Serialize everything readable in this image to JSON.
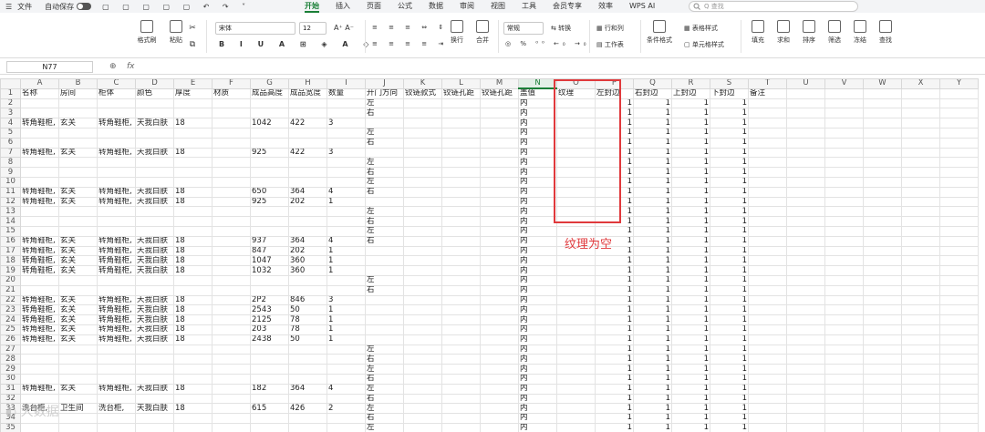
{
  "titlebar": {
    "file": "文件",
    "autosave": "自动保存",
    "tabs": [
      "开始",
      "插入",
      "页面",
      "公式",
      "数据",
      "审阅",
      "视图",
      "工具",
      "会员专享",
      "效率",
      "WPS AI"
    ],
    "active_tab": "开始",
    "search_placeholder": "Q 查找"
  },
  "ribbon": {
    "format_painter": "格式刷",
    "paste": "粘贴",
    "font": "宋体",
    "font_size": "12",
    "number_format": "常规",
    "convert": "转换",
    "wrap": "换行",
    "merge": "合并",
    "rows_cols": "行和列",
    "worksheet": "工作表",
    "conditional": "条件格式",
    "table_style": "表格样式",
    "cell_style": "单元格样式",
    "fill": "填充",
    "sum": "求和",
    "sort": "排序",
    "filter": "筛选",
    "freeze": "冻结",
    "find": "查找"
  },
  "formula": {
    "namebox": "N77",
    "fx": "fx"
  },
  "grid": {
    "columns": [
      "A",
      "B",
      "C",
      "D",
      "E",
      "F",
      "G",
      "H",
      "I",
      "J",
      "K",
      "L",
      "M",
      "N",
      "O",
      "P",
      "Q",
      "R",
      "S",
      "T",
      "U",
      "V",
      "W",
      "X",
      "Y"
    ],
    "selected_column": "N",
    "header_row": [
      "名称",
      "房间",
      "柜体",
      "颜色",
      "厚度",
      "材质",
      "成品高度",
      "成品宽度",
      "数量",
      "开门方向",
      "铰链款式",
      "铰链孔距",
      "铰链孔距",
      "盖值",
      "纹理",
      "左封边",
      "右封边",
      "上封边",
      "下封边",
      "备注"
    ],
    "rows": [
      [
        "",
        "",
        "",
        "",
        "",
        "",
        "",
        "",
        "",
        "左",
        "",
        "",
        "",
        "内",
        "",
        "1",
        "1",
        "1",
        "1"
      ],
      [
        "",
        "",
        "",
        "",
        "",
        "",
        "",
        "",
        "",
        "右",
        "",
        "",
        "",
        "内",
        "",
        "1",
        "1",
        "1",
        "1"
      ],
      [
        "转角鞋柜,",
        "玄关",
        "转角鞋柜,",
        "天我白肤",
        "18",
        "",
        "1042",
        "422",
        "3",
        "",
        "",
        "",
        "",
        "内",
        "",
        "1",
        "1",
        "1",
        "1"
      ],
      [
        "",
        "",
        "",
        "",
        "",
        "",
        "",
        "",
        "",
        "左",
        "",
        "",
        "",
        "内",
        "",
        "1",
        "1",
        "1",
        "1"
      ],
      [
        "",
        "",
        "",
        "",
        "",
        "",
        "",
        "",
        "",
        "右",
        "",
        "",
        "",
        "内",
        "",
        "1",
        "1",
        "1",
        "1"
      ],
      [
        "转角鞋柜,",
        "玄关",
        "转角鞋柜,",
        "天我白肤",
        "18",
        "",
        "925",
        "422",
        "3",
        "",
        "",
        "",
        "",
        "内",
        "",
        "1",
        "1",
        "1",
        "1"
      ],
      [
        "",
        "",
        "",
        "",
        "",
        "",
        "",
        "",
        "",
        "左",
        "",
        "",
        "",
        "内",
        "",
        "1",
        "1",
        "1",
        "1"
      ],
      [
        "",
        "",
        "",
        "",
        "",
        "",
        "",
        "",
        "",
        "右",
        "",
        "",
        "",
        "内",
        "",
        "1",
        "1",
        "1",
        "1"
      ],
      [
        "",
        "",
        "",
        "",
        "",
        "",
        "",
        "",
        "",
        "左",
        "",
        "",
        "",
        "内",
        "",
        "1",
        "1",
        "1",
        "1"
      ],
      [
        "转角鞋柜,",
        "玄关",
        "转角鞋柜,",
        "天我白肤",
        "18",
        "",
        "650",
        "364",
        "4",
        "右",
        "",
        "",
        "",
        "内",
        "",
        "1",
        "1",
        "1",
        "1"
      ],
      [
        "转角鞋柜,",
        "玄关",
        "转角鞋柜,",
        "天我白肤",
        "18",
        "",
        "925",
        "202",
        "1",
        "",
        "",
        "",
        "",
        "内",
        "",
        "1",
        "1",
        "1",
        "1"
      ],
      [
        "",
        "",
        "",
        "",
        "",
        "",
        "",
        "",
        "",
        "左",
        "",
        "",
        "",
        "内",
        "",
        "1",
        "1",
        "1",
        "1"
      ],
      [
        "",
        "",
        "",
        "",
        "",
        "",
        "",
        "",
        "",
        "右",
        "",
        "",
        "",
        "内",
        "",
        "1",
        "1",
        "1",
        "1"
      ],
      [
        "",
        "",
        "",
        "",
        "",
        "",
        "",
        "",
        "",
        "左",
        "",
        "",
        "",
        "内",
        "",
        "1",
        "1",
        "1",
        "1"
      ],
      [
        "转角鞋柜,",
        "玄关",
        "转角鞋柜,",
        "天我白肤",
        "18",
        "",
        "937",
        "364",
        "4",
        "右",
        "",
        "",
        "",
        "内",
        "",
        "1",
        "1",
        "1",
        "1"
      ],
      [
        "转角鞋柜,",
        "玄关",
        "转角鞋柜,",
        "天我白肤",
        "18",
        "",
        "847",
        "202",
        "1",
        "",
        "",
        "",
        "",
        "内",
        "",
        "1",
        "1",
        "1",
        "1"
      ],
      [
        "转角鞋柜,",
        "玄关",
        "转角鞋柜,",
        "天我白肤",
        "18",
        "",
        "1047",
        "360",
        "1",
        "",
        "",
        "",
        "",
        "内",
        "",
        "1",
        "1",
        "1",
        "1"
      ],
      [
        "转角鞋柜,",
        "玄关",
        "转角鞋柜,",
        "天我白肤",
        "18",
        "",
        "1032",
        "360",
        "1",
        "",
        "",
        "",
        "",
        "内",
        "",
        "1",
        "1",
        "1",
        "1"
      ],
      [
        "",
        "",
        "",
        "",
        "",
        "",
        "",
        "",
        "",
        "左",
        "",
        "",
        "",
        "内",
        "",
        "1",
        "1",
        "1",
        "1"
      ],
      [
        "",
        "",
        "",
        "",
        "",
        "",
        "",
        "",
        "",
        "右",
        "",
        "",
        "",
        "内",
        "",
        "1",
        "1",
        "1",
        "1"
      ],
      [
        "转角鞋柜,",
        "玄关",
        "转角鞋柜,",
        "天我白肤",
        "18",
        "",
        "2P2",
        "846",
        "3",
        "",
        "",
        "",
        "",
        "内",
        "",
        "1",
        "1",
        "1",
        "1"
      ],
      [
        "转角鞋柜,",
        "玄关",
        "转角鞋柜,",
        "天我白肤",
        "18",
        "",
        "2543",
        "50",
        "1",
        "",
        "",
        "",
        "",
        "内",
        "",
        "1",
        "1",
        "1",
        "1"
      ],
      [
        "转角鞋柜,",
        "玄关",
        "转角鞋柜,",
        "天我白肤",
        "18",
        "",
        "2125",
        "78",
        "1",
        "",
        "",
        "",
        "",
        "内",
        "",
        "1",
        "1",
        "1",
        "1"
      ],
      [
        "转角鞋柜,",
        "玄关",
        "转角鞋柜,",
        "天我白肤",
        "18",
        "",
        "203",
        "78",
        "1",
        "",
        "",
        "",
        "",
        "内",
        "",
        "1",
        "1",
        "1",
        "1"
      ],
      [
        "转角鞋柜,",
        "玄关",
        "转角鞋柜,",
        "天我白肤",
        "18",
        "",
        "2438",
        "50",
        "1",
        "",
        "",
        "",
        "",
        "内",
        "",
        "1",
        "1",
        "1",
        "1"
      ],
      [
        "",
        "",
        "",
        "",
        "",
        "",
        "",
        "",
        "",
        "左",
        "",
        "",
        "",
        "内",
        "",
        "1",
        "1",
        "1",
        "1"
      ],
      [
        "",
        "",
        "",
        "",
        "",
        "",
        "",
        "",
        "",
        "右",
        "",
        "",
        "",
        "内",
        "",
        "1",
        "1",
        "1",
        "1"
      ],
      [
        "",
        "",
        "",
        "",
        "",
        "",
        "",
        "",
        "",
        "左",
        "",
        "",
        "",
        "内",
        "",
        "1",
        "1",
        "1",
        "1"
      ],
      [
        "",
        "",
        "",
        "",
        "",
        "",
        "",
        "",
        "",
        "右",
        "",
        "",
        "",
        "内",
        "",
        "1",
        "1",
        "1",
        "1"
      ],
      [
        "转角鞋柜,",
        "玄关",
        "转角鞋柜,",
        "天我白肤",
        "18",
        "",
        "182",
        "364",
        "4",
        "左",
        "",
        "",
        "",
        "内",
        "",
        "1",
        "1",
        "1",
        "1"
      ],
      [
        "",
        "",
        "",
        "",
        "",
        "",
        "",
        "",
        "",
        "右",
        "",
        "",
        "",
        "内",
        "",
        "1",
        "1",
        "1",
        "1"
      ],
      [
        "洗台柜,",
        "卫生间",
        "洗台柜,",
        "天我白肤",
        "18",
        "",
        "615",
        "426",
        "2",
        "左",
        "",
        "",
        "",
        "内",
        "",
        "1",
        "1",
        "1",
        "1"
      ],
      [
        "",
        "",
        "",
        "",
        "",
        "",
        "",
        "",
        "",
        "右",
        "",
        "",
        "",
        "内",
        "",
        "1",
        "1",
        "1",
        "1"
      ],
      [
        "",
        "",
        "",
        "",
        "",
        "",
        "",
        "",
        "",
        "左",
        "",
        "",
        "",
        "内",
        "",
        "1",
        "1",
        "1",
        "1"
      ]
    ]
  },
  "annotation": {
    "label": "纹理为空",
    "color": "#e0393c"
  }
}
